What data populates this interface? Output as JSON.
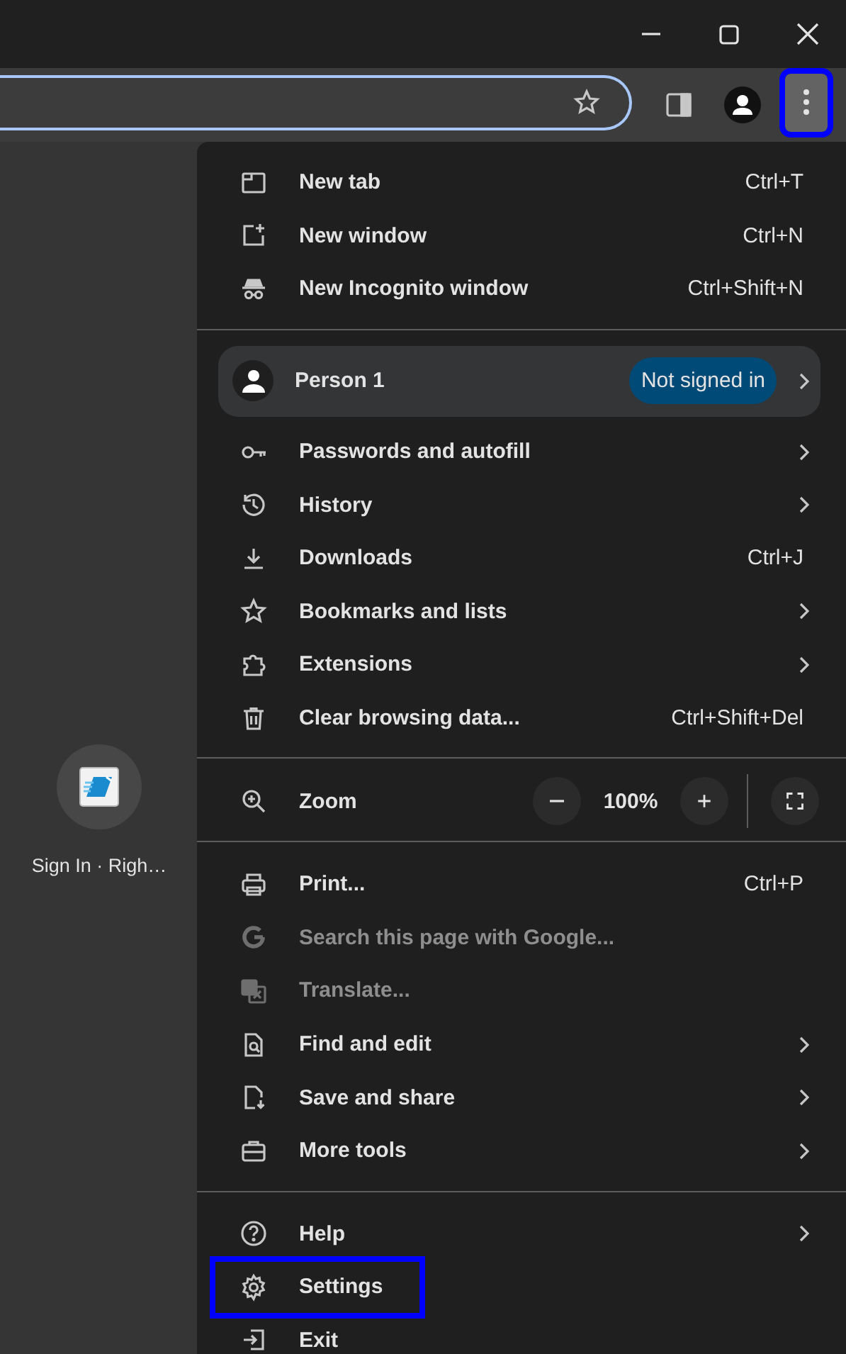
{
  "toolbar": {
    "menu_button": {
      "highlighted": true
    }
  },
  "new_tab_page": {
    "shortcuts": [
      {
        "title": "Sign In · Righ…"
      }
    ]
  },
  "menu": {
    "sections": [
      {
        "items": [
          {
            "kind": "item",
            "label": "New tab",
            "shortcut": "Ctrl+T",
            "submenu": false,
            "disabled": false,
            "highlighted": false
          },
          {
            "kind": "item",
            "label": "New window",
            "shortcut": "Ctrl+N",
            "submenu": false,
            "disabled": false,
            "highlighted": false
          },
          {
            "kind": "item",
            "label": "New Incognito window",
            "shortcut": "Ctrl+Shift+N",
            "submenu": false,
            "disabled": false,
            "highlighted": false
          }
        ]
      },
      {
        "items": [
          {
            "kind": "profile",
            "name": "Person 1",
            "status": "Not signed in",
            "submenu": true
          },
          {
            "kind": "item",
            "label": "Passwords and autofill",
            "submenu": true,
            "disabled": false,
            "highlighted": false
          },
          {
            "kind": "item",
            "label": "History",
            "submenu": true,
            "disabled": false,
            "highlighted": false
          },
          {
            "kind": "item",
            "label": "Downloads",
            "shortcut": "Ctrl+J",
            "submenu": false,
            "disabled": false,
            "highlighted": false
          },
          {
            "kind": "item",
            "label": "Bookmarks and lists",
            "submenu": true,
            "disabled": false,
            "highlighted": false
          },
          {
            "kind": "item",
            "label": "Extensions",
            "submenu": true,
            "disabled": false,
            "highlighted": false
          },
          {
            "kind": "item",
            "label": "Clear browsing data...",
            "shortcut": "Ctrl+Shift+Del",
            "submenu": false,
            "disabled": false,
            "highlighted": false
          }
        ]
      },
      {
        "items": [
          {
            "kind": "zoom",
            "label": "Zoom",
            "value": "100%"
          }
        ]
      },
      {
        "items": [
          {
            "kind": "item",
            "label": "Print...",
            "shortcut": "Ctrl+P",
            "submenu": false,
            "disabled": false,
            "highlighted": false
          },
          {
            "kind": "item",
            "label": "Search this page with Google...",
            "submenu": false,
            "disabled": true,
            "highlighted": false
          },
          {
            "kind": "item",
            "label": "Translate...",
            "submenu": false,
            "disabled": true,
            "highlighted": false
          },
          {
            "kind": "item",
            "label": "Find and edit",
            "submenu": true,
            "disabled": false,
            "highlighted": false
          },
          {
            "kind": "item",
            "label": "Save and share",
            "submenu": true,
            "disabled": false,
            "highlighted": false
          },
          {
            "kind": "item",
            "label": "More tools",
            "submenu": true,
            "disabled": false,
            "highlighted": false
          }
        ]
      },
      {
        "items": [
          {
            "kind": "item",
            "label": "Help",
            "submenu": true,
            "disabled": false,
            "highlighted": false
          },
          {
            "kind": "item",
            "label": "Settings",
            "submenu": false,
            "disabled": false,
            "highlighted": true
          },
          {
            "kind": "item",
            "label": "Exit",
            "submenu": false,
            "disabled": false,
            "highlighted": false
          }
        ]
      }
    ]
  }
}
